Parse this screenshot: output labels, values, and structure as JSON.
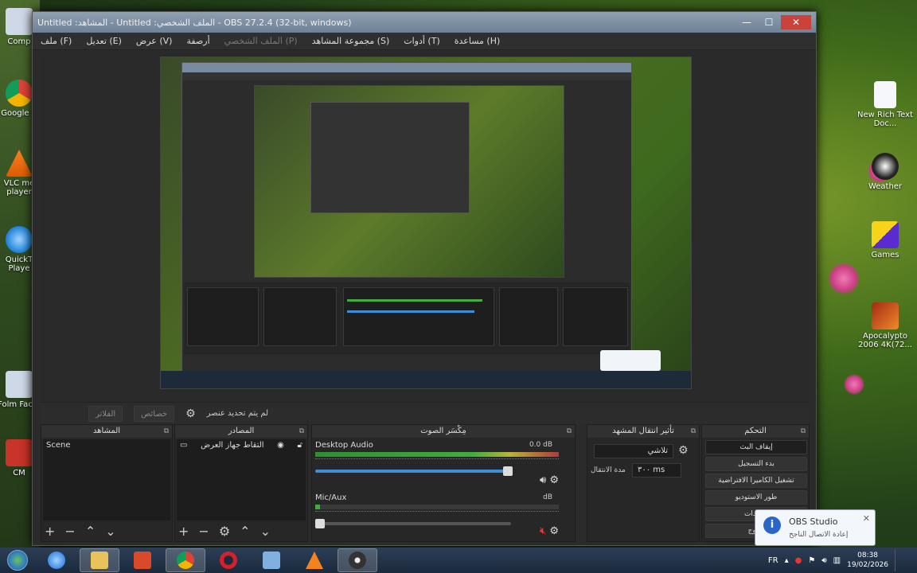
{
  "desktop": {
    "left_icons": [
      "Comp",
      "Google C",
      "VLC me player",
      "QuickT Playe",
      "Folm Facto",
      "CM"
    ],
    "right_icons": [
      "New Rich Text Doc...",
      "Weather",
      "Games",
      "Apocalypto 2006 4K(72..."
    ]
  },
  "window": {
    "title": "OBS 27.2.4 (32-bit, windows) - الملف الشخصي: Untitled - المشاهد: Untitled",
    "buttons": {
      "minimize": "—",
      "maximize": "☐",
      "close": "✕"
    }
  },
  "menu": [
    {
      "label": "ملف (F)",
      "disabled": false
    },
    {
      "label": "تعديل (E)",
      "disabled": false
    },
    {
      "label": "عرض (V)",
      "disabled": false
    },
    {
      "label": "أرصفة",
      "disabled": false
    },
    {
      "label": "الملف الشخصي (P)",
      "disabled": true
    },
    {
      "label": "مجموعة المشاهد (S)",
      "disabled": false
    },
    {
      "label": "أدوات (T)",
      "disabled": false
    },
    {
      "label": "مساعدة (H)",
      "disabled": false
    }
  ],
  "controls_bar": {
    "source_label": "لم يتم تحديد عنصر",
    "properties_btn": "خصائص",
    "filters_btn": "الفلاتر"
  },
  "docks": {
    "scenes": {
      "title": "المشاهد",
      "items": [
        "Scene"
      ]
    },
    "sources": {
      "title": "المصادر",
      "items": [
        "التقاط جهاز العرض"
      ]
    },
    "mixer": {
      "title": "مِكْسَر الصوت",
      "tracks": [
        {
          "name": "Desktop Audio",
          "db": "0.0 dB",
          "muted": false,
          "level": 0.92
        },
        {
          "name": "Mic/Aux",
          "db": "dB",
          "muted": true,
          "level": 0.02
        }
      ]
    },
    "transitions": {
      "title": "تأثير انتقال المشهد",
      "type": "تلاشي",
      "duration_label": "مدة الانتقال",
      "duration": "٣٠٠ ms"
    },
    "controls": {
      "title": "التحكم",
      "buttons": [
        "إيقاف البث",
        "بدء التسجيل",
        "تشغيل الكاميرا الافتراضية",
        "طور الاستوديو",
        "إعدادات",
        "خروج"
      ]
    }
  },
  "taskbar": {
    "apps": [
      "start",
      "ie",
      "explorer",
      "media-player",
      "chrome",
      "opera",
      "network",
      "vlc",
      "obs"
    ],
    "lang": "FR",
    "time": "08:38",
    "date": "19/02/2026"
  },
  "toast": {
    "title": "OBS Studio",
    "message": "إعادة الاتصال الناجح"
  },
  "colors": {
    "accent_blue": "#3b8fd6",
    "meter_green": "#3fae3f",
    "mute_red": "#e33333"
  }
}
